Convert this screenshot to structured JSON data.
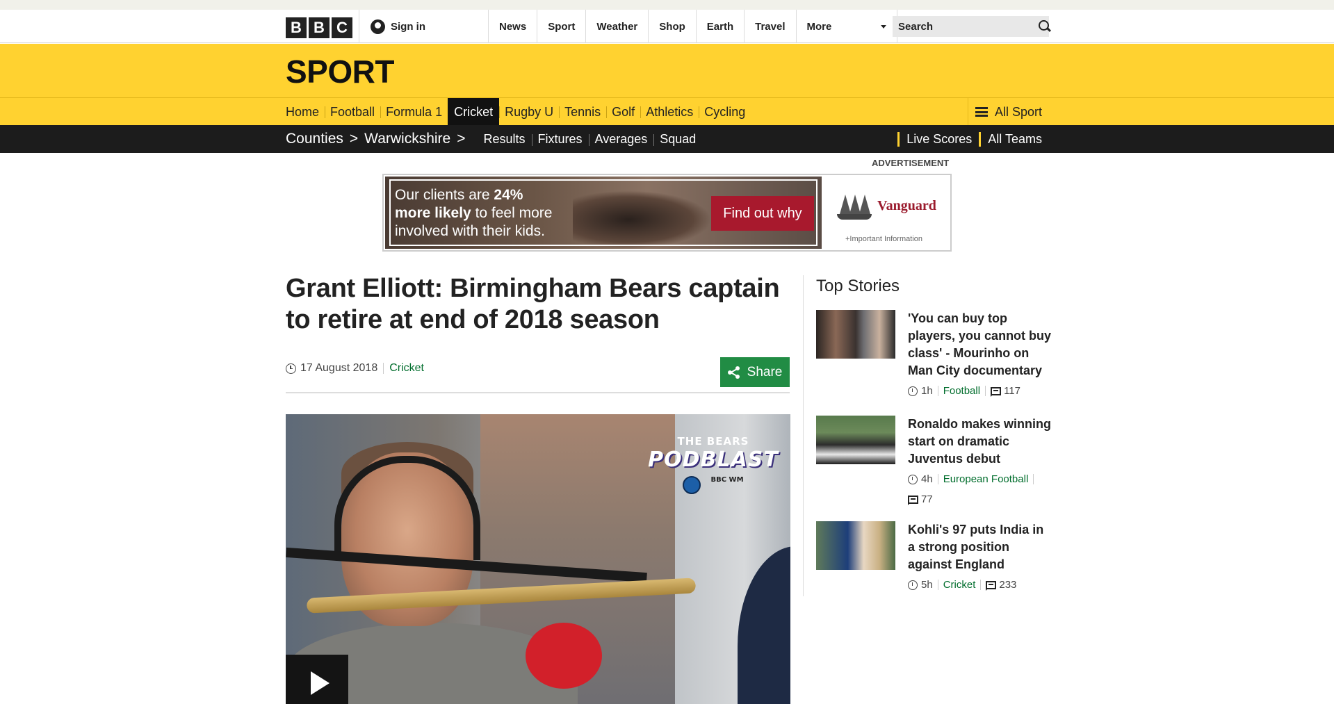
{
  "global": {
    "logo_letters": [
      "B",
      "B",
      "C"
    ],
    "signin": "Sign in",
    "nav": [
      "News",
      "Sport",
      "Weather",
      "Shop",
      "Earth",
      "Travel",
      "More"
    ],
    "search_placeholder": "Search"
  },
  "sport": {
    "title": "SPORT",
    "nav": [
      "Home",
      "Football",
      "Formula 1",
      "Cricket",
      "Rugby U",
      "Tennis",
      "Golf",
      "Athletics",
      "Cycling"
    ],
    "active": "Cricket",
    "all_sport": "All Sport"
  },
  "subnav": {
    "crumbs": [
      "Counties",
      "Warwickshire"
    ],
    "sep": ">",
    "links": [
      "Results",
      "Fixtures",
      "Averages",
      "Squad"
    ],
    "right": [
      "Live Scores",
      "All Teams"
    ]
  },
  "ad": {
    "label": "ADVERTISEMENT",
    "line1_a": "Our clients are ",
    "line1_b": "24%",
    "line2_a": "more likely",
    "line2_b": " to feel more",
    "line3": "involved with their kids.",
    "cta": "Find out why",
    "brand": "Vanguard",
    "info": "+Important Information"
  },
  "article": {
    "headline": "Grant Elliott: Birmingham Bears captain to retire at end of 2018 season",
    "date": "17 August 2018",
    "section": "Cricket",
    "share": "Share",
    "video_overlay_top": "THE BEARS",
    "video_overlay_main": "PODBLAST",
    "video_overlay_station": "BBC WM"
  },
  "top_stories": {
    "title": "Top Stories",
    "items": [
      {
        "title": "'You can buy top players, you cannot buy class' - Mourinho on Man City documentary",
        "time": "1h",
        "section": "Football",
        "comments": "117"
      },
      {
        "title": "Ronaldo makes winning start on dramatic Juventus debut",
        "time": "4h",
        "section": "European Football",
        "comments": "77"
      },
      {
        "title": "Kohli's 97 puts India in a strong position against England",
        "time": "5h",
        "section": "Cricket",
        "comments": "233"
      }
    ]
  }
}
